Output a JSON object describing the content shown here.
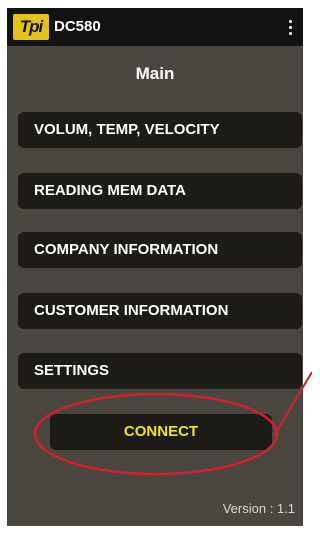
{
  "app": {
    "logo_text": "Tpi",
    "title": "DC580"
  },
  "main": {
    "heading": "Main"
  },
  "menu": [
    {
      "label": "VOLUM, TEMP, VELOCITY"
    },
    {
      "label": "READING MEM DATA"
    },
    {
      "label": "COMPANY INFORMATION"
    },
    {
      "label": "CUSTOMER INFORMATION"
    },
    {
      "label": "SETTINGS"
    }
  ],
  "connect": {
    "label": "CONNECT"
  },
  "footer": {
    "version": "Version : 1.1"
  },
  "colors": {
    "background": "#4a4640",
    "button": "#1c1b18",
    "connect_text": "#f0e21c",
    "logo_bg": "#e3c31b",
    "annotation": "#d4202a"
  },
  "icons": {
    "overflow_menu": "more-vert-icon"
  }
}
